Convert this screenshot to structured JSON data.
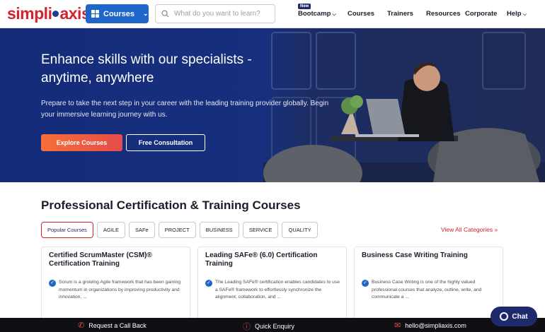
{
  "brand": {
    "logo_text_left": "simpli",
    "logo_text_right": "axis"
  },
  "header": {
    "courses_label": "Courses",
    "search_placeholder": "What do you want to learn?",
    "nav": [
      {
        "label": "Bootcamp",
        "badge": "New",
        "has_dropdown": true
      },
      {
        "label": "Courses",
        "has_dropdown": false
      },
      {
        "label": "Trainers",
        "has_dropdown": false
      },
      {
        "label": "Resources",
        "has_dropdown": false
      },
      {
        "label": "Corporate",
        "has_dropdown": false
      },
      {
        "label": "Help",
        "has_dropdown": true
      }
    ]
  },
  "hero": {
    "title": "Enhance skills with our specialists - anytime, anywhere",
    "subtitle": "Prepare to take the next step in your career with the leading training provider globally. Begin your immersive learning journey with us.",
    "primary_button": "Explore Courses",
    "secondary_button": "Free Consultation"
  },
  "section": {
    "title": "Professional Certification & Training Courses",
    "chips": [
      {
        "label": "Popular Courses",
        "active": true
      },
      {
        "label": "AGILE",
        "active": false
      },
      {
        "label": "SAFe",
        "active": false
      },
      {
        "label": "PROJECT",
        "active": false
      },
      {
        "label": "BUSINESS",
        "active": false
      },
      {
        "label": "SERVICE",
        "active": false
      },
      {
        "label": "QUALITY",
        "active": false
      }
    ],
    "view_all": "View All Categories »"
  },
  "cards": [
    {
      "title": "Certified ScrumMaster (CSM)® Certification Training",
      "description": "Scrum is a growing Agile framework that has been gaining momentum in organizations by improving productivity and innovation, ..."
    },
    {
      "title": "Leading SAFe® (6.0) Certification Training",
      "description": "The Leading SAFe® certification enables candidates to use a SAFe® framework to effortlessly synchronize the alignment, collaboration, and ..."
    },
    {
      "title": "Business Case Writing Training",
      "description": "Business Case Writing is one of the highly valued professional courses that analyze, outline, write, and communicate a ..."
    }
  ],
  "bottom_bar": {
    "call_back": "Request a Call Back",
    "enquiry": "Quick Enquiry",
    "email": "hello@simpliaxis.com"
  },
  "chat_label": "Chat",
  "colors": {
    "brand_red": "#d3232f",
    "brand_blue": "#1f66c9",
    "hero_bg": "#17307e",
    "navy": "#1d2a6b"
  }
}
